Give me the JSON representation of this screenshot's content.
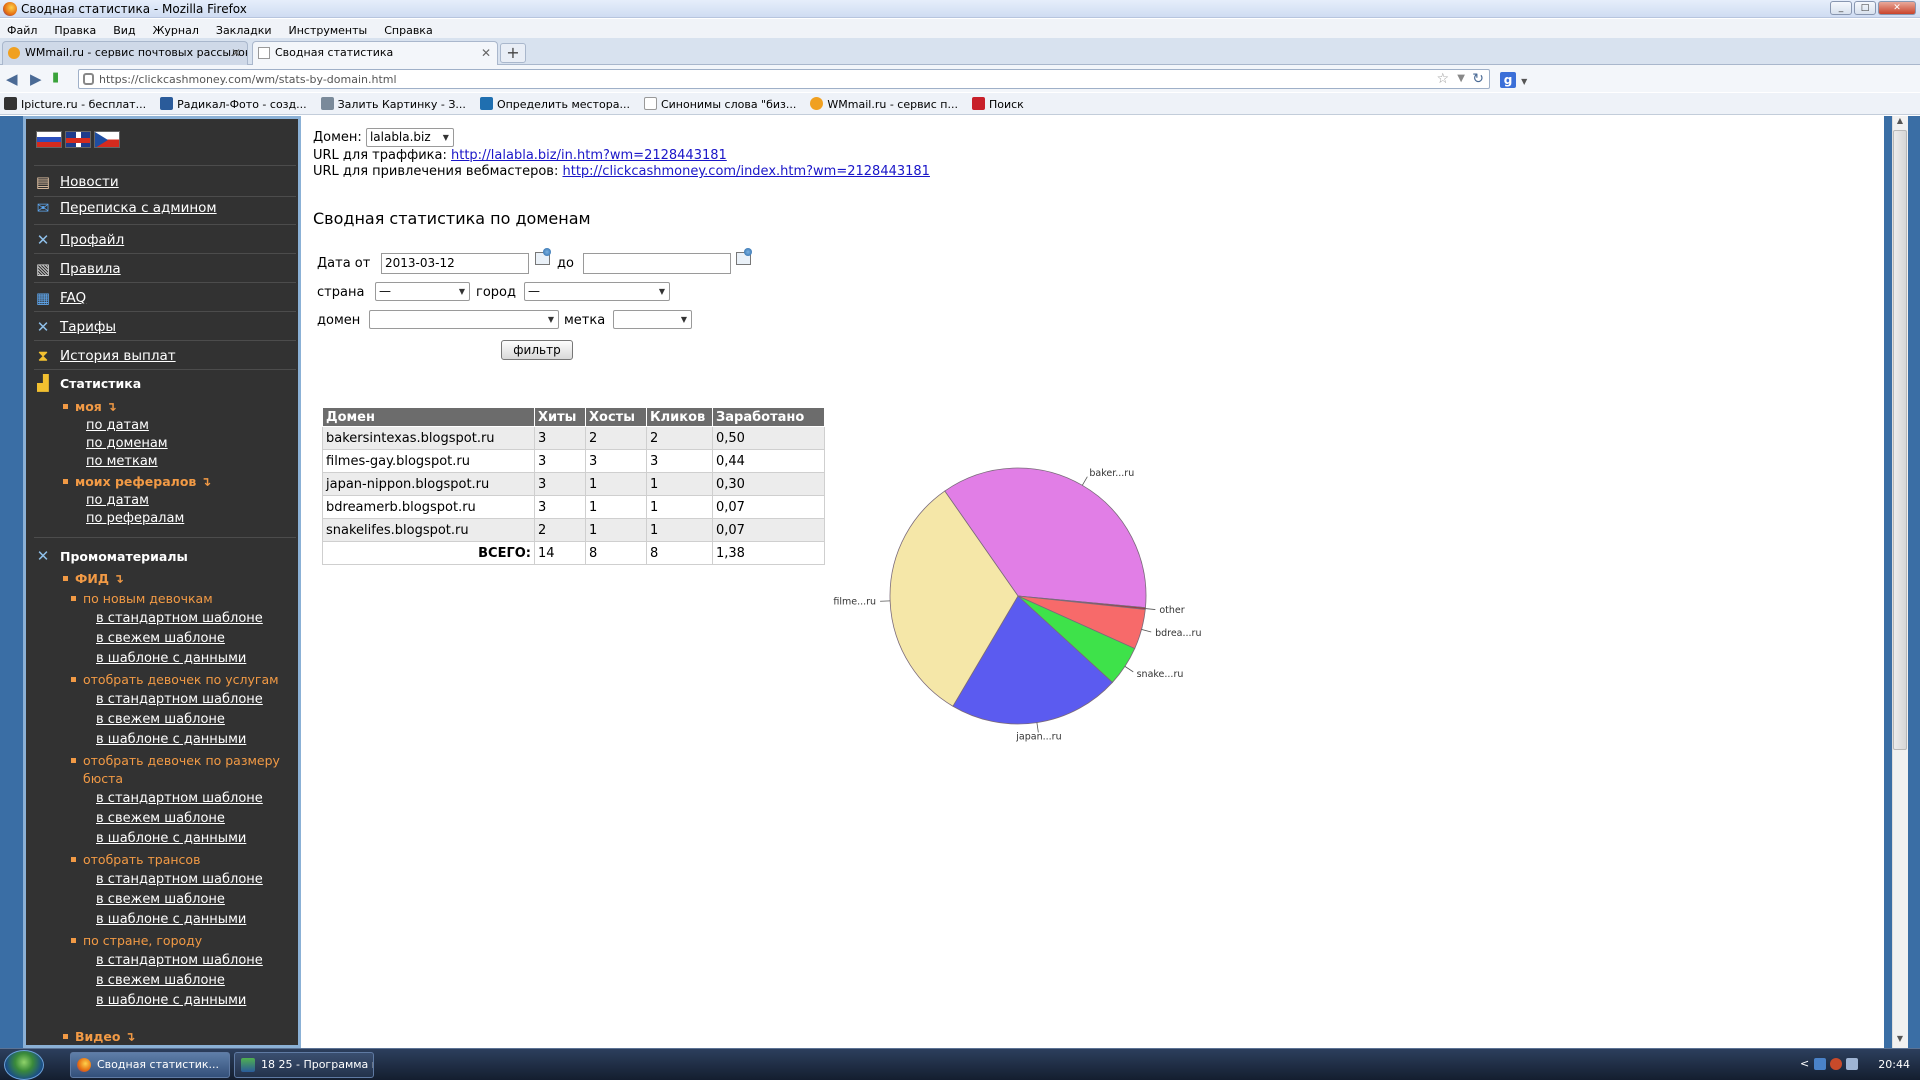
{
  "window": {
    "title": "Сводная статистика - Mozilla Firefox",
    "controls": [
      "_",
      "□",
      "✕"
    ]
  },
  "menubar": [
    "Файл",
    "Правка",
    "Вид",
    "Журнал",
    "Закладки",
    "Инструменты",
    "Справка"
  ],
  "tabs": [
    {
      "label": "WMmail.ru - сервис почтовых рассылок..."
    },
    {
      "label": "Сводная статистика"
    }
  ],
  "navbar": {
    "url": "https://clickcashmoney.com/wm/stats-by-domain.html",
    "search_engine": "g"
  },
  "bookmarks": [
    {
      "label": "Ipicture.ru - бесплат...",
      "color": "#333333"
    },
    {
      "label": "Радикал-Фото - созд...",
      "color": "#2a5b9a"
    },
    {
      "label": "Залить Картинку - З...",
      "color": "#7a8a9a"
    },
    {
      "label": "Определить местора...",
      "color": "#1f6fb0"
    },
    {
      "label": "Синонимы слова \"биз...",
      "color": "#ffffff"
    },
    {
      "label": "WMmail.ru - сервис п...",
      "color": "#f0a020"
    },
    {
      "label": "Поиск",
      "color": "#c8202a"
    }
  ],
  "sidebar": {
    "menu": [
      {
        "label": "Новости",
        "icon": "news-icon"
      },
      {
        "label": "Переписка с админом",
        "icon": "mail-icon"
      },
      {
        "label": "Профайл",
        "icon": "tools-icon"
      },
      {
        "label": "Правила",
        "icon": "rules-icon"
      },
      {
        "label": "FAQ",
        "icon": "faq-icon"
      },
      {
        "label": "Тарифы",
        "icon": "tools-icon"
      },
      {
        "label": "История выплат",
        "icon": "hourglass-icon"
      }
    ],
    "stats_header": "Статистика",
    "my_label": "моя",
    "my_links": [
      "по датам",
      "по доменам",
      "по меткам"
    ],
    "referrals_label": "моих рефералов",
    "referrals_links": [
      "по датам",
      "по рефералам"
    ],
    "promo_header": "Промоматериалы",
    "feed_label": "ФИД",
    "feed_groups": [
      {
        "label": "по новым девочкам",
        "links": [
          "в стандартном шаблоне",
          "в свежем шаблоне",
          "в шаблоне с данными"
        ]
      },
      {
        "label": "отобрать девочек по услугам",
        "links": [
          "в стандартном шаблоне",
          "в свежем шаблоне",
          "в шаблоне с данными"
        ]
      },
      {
        "label": "отобрать девочек по размеру",
        "label2": "бюста",
        "links": [
          "в стандартном шаблоне",
          "в свежем шаблоне",
          "в шаблоне с данными"
        ]
      },
      {
        "label": "отобрать трансов",
        "links": [
          "в стандартном шаблоне",
          "в свежем шаблоне",
          "в шаблоне с данными"
        ]
      },
      {
        "label": "по стране, городу",
        "links": [
          "в стандартном шаблоне",
          "в свежем шаблоне",
          "в шаблоне с данными"
        ]
      }
    ],
    "video_label": "Видео"
  },
  "main": {
    "domain_label": "Домен:",
    "domain_value": "lalabla.biz",
    "traffic_url_label": "URL для траффика:",
    "traffic_url": "http://lalabla.biz/in.htm?wm=2128443181",
    "webmaster_url_label": "URL для привлечения вебмастеров:",
    "webmaster_url": "http://clickcashmoney.com/index.htm?wm=2128443181",
    "heading": "Сводная статистика по доменам",
    "filter": {
      "date_from_label": "Дата от",
      "date_from_value": "2013-03-12",
      "date_to_label": "до",
      "date_to_value": "",
      "country_label": "страна",
      "country_value": "—",
      "city_label": "город",
      "city_value": "—",
      "domain_label": "домен",
      "domain_value": "",
      "tag_label": "метка",
      "tag_value": "",
      "button": "фильтр"
    },
    "table": {
      "headers": [
        "Домен",
        "Хиты",
        "Хосты",
        "Кликов",
        "Заработано"
      ],
      "rows": [
        [
          "bakersintexas.blogspot.ru",
          "3",
          "2",
          "2",
          "0,50"
        ],
        [
          "filmes-gay.blogspot.ru",
          "3",
          "3",
          "3",
          "0,44"
        ],
        [
          "japan-nippon.blogspot.ru",
          "3",
          "1",
          "1",
          "0,30"
        ],
        [
          "bdreamerb.blogspot.ru",
          "3",
          "1",
          "1",
          "0,07"
        ],
        [
          "snakelifes.blogspot.ru",
          "2",
          "1",
          "1",
          "0,07"
        ]
      ],
      "total": [
        "ВСЕГО:",
        "14",
        "8",
        "8",
        "1,38"
      ]
    }
  },
  "chart_data": {
    "type": "pie",
    "title": "",
    "slices": [
      {
        "label": "baker...ru",
        "value": 0.5,
        "color": "#e17ee6"
      },
      {
        "label": "other",
        "value": 0.003,
        "color": "#a83030"
      },
      {
        "label": "bdrea...ru",
        "value": 0.07,
        "color": "#f76a6a"
      },
      {
        "label": "snake...ru",
        "value": 0.07,
        "color": "#3ee24a"
      },
      {
        "label": "japan...ru",
        "value": 0.3,
        "color": "#5b5bf0"
      },
      {
        "label": "filme...ru",
        "value": 0.44,
        "color": "#f5e7a8"
      }
    ]
  },
  "taskbar": {
    "items": [
      {
        "label": "Сводная статистик...",
        "active": true
      },
      {
        "label": "18 25 - Программа п...",
        "active": false
      }
    ],
    "tray_arrow": "<",
    "clock": "20:44"
  }
}
